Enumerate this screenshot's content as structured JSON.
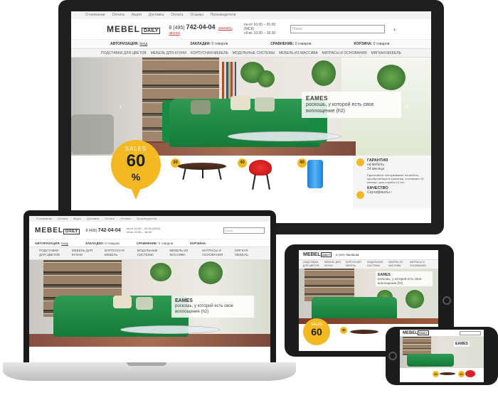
{
  "site": {
    "topnav": [
      "О компании",
      "Оплата",
      "Акции",
      "Доставка",
      "Оплата",
      "Отзывы",
      "Производители"
    ],
    "logo_main": "MEBEL",
    "logo_sub": "DAILY",
    "phone_prefix": "8 (495)",
    "phone_number": "742-04-04",
    "callback_label": "заказать звонок",
    "hours_line1": "пн-пт 10.00 – 20.00 (МСК)",
    "hours_line2": "сб-вс 10.00 – 18.00",
    "search_placeholder": "Поиск",
    "search_arrow": "›",
    "userbar": {
      "auth_label": "АВТОРИЗАЦИЯ:",
      "auth_link": "вход",
      "bookmarks_label": "ЗАКЛАДКИ:",
      "bookmarks_value": "0 товаров",
      "compare_label": "СРАВНЕНИЕ:",
      "compare_value": "0 товаров",
      "cart_label": "КОРЗИНА:",
      "cart_value": "0 товаров"
    },
    "catnav": [
      "ПОДСТАВКИ ДЛЯ ЦВЕТОВ",
      "МЕБЕЛЬ ДЛЯ КУХНИ",
      "КОРПУСНАЯ МЕБЕЛЬ",
      "МОДУЛЬНЫЕ СИСТЕМЫ",
      "МЕБЕЛЬ ИЗ МАССИВА",
      "МАТРАСЫ И ОСНОВАНИЯ",
      "МЯГКАЯ МЕБЕЛЬ"
    ],
    "hero": {
      "title": "EAMES",
      "subtitle": "роскошь, у которой есть свое воплощение (h2)",
      "prev_arrow": "‹",
      "next_arrow": "›"
    },
    "sales": {
      "label": "SALES",
      "percent": "60",
      "sign": "%"
    },
    "products": [
      {
        "badge": "30"
      },
      {
        "badge": "40"
      },
      {
        "badge": "40"
      }
    ],
    "guarantee": {
      "title": "ГАРАНТИЯ",
      "line1": "на мебель",
      "line2": "24 месяца",
      "desc": "Гарантийное обслуживание на мебель, приобретённую в компании, составляет 24 месяца, срок службы 10 лет.",
      "quality_title": "КАЧЕСТВО",
      "quality_line": "Сертификаты ›"
    }
  },
  "laptop_site": {
    "hero_title": "EAMES",
    "hero_subtitle": "роскошь, у которой есть свое воплощение (h2)",
    "catnav": [
      "ПОДСТАВКИ ДЛЯ ЦВЕТОВ",
      "МЕБЕЛЬ ДЛЯ КУХНИ",
      "КОРПУСНАЯ МЕБЕЛЬ",
      "МОДУЛЬНЫЕ СИСТЕМЫ",
      "МЕБЕЛЬ ИЗ МАССИВА",
      "МАТРАСЫ И ОСНОВАНИЯ",
      "МЯГКАЯ МЕБЕЛЬ"
    ]
  },
  "tablet_site": {
    "hero_title": "EAMES",
    "hero_subtitle": "роскошь, у которой есть свое воплощение (h2)",
    "sales_label": "SALES",
    "sales_percent": "60",
    "badge": "30"
  },
  "phone_site": {
    "hero_title": "EAMES",
    "badge_1": "30",
    "badge_2": "40"
  },
  "colors": {
    "accent_yellow": "#f4b823",
    "sofa_green": "#1f8c44",
    "device_black": "#1f1f1f"
  }
}
